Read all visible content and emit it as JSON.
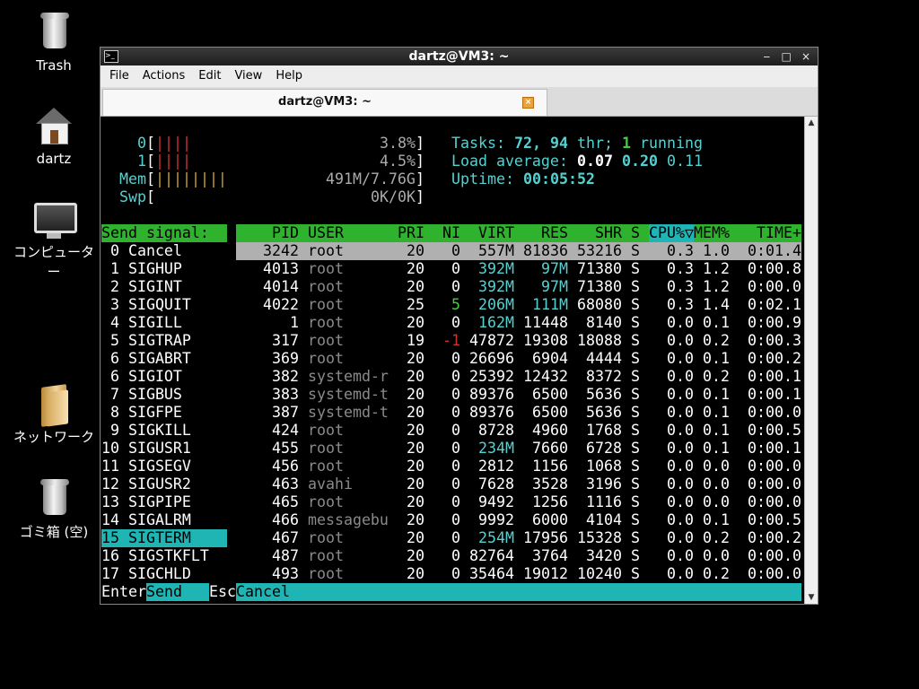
{
  "desktop": {
    "icons": [
      {
        "label": "Trash",
        "icon": "trash-icon"
      },
      {
        "label": "dartz",
        "icon": "home-folder-icon"
      },
      {
        "label": "コンピューター",
        "icon": "computer-icon"
      },
      {
        "label": "ネットワーク",
        "icon": "network-folder-icon"
      },
      {
        "label": "ゴミ箱 (空)",
        "icon": "trash-empty-icon"
      }
    ]
  },
  "window": {
    "title": "dartz@VM3: ~",
    "controls": {
      "minimize": "‒",
      "maximize": "□",
      "close": "×"
    },
    "menu": [
      "File",
      "Actions",
      "Edit",
      "View",
      "Help"
    ],
    "tab_title": "dartz@VM3: ~",
    "tab_close": "×"
  },
  "htop": {
    "cpu0": {
      "label": "0",
      "bar": "||||",
      "value": "3.8%"
    },
    "cpu1": {
      "label": "1",
      "bar": "||||",
      "value": "4.5%"
    },
    "mem": {
      "label": "Mem",
      "bar": "||||||||",
      "value": "491M/7.76G"
    },
    "swp": {
      "label": "Swp",
      "bar": "",
      "value": "0K/0K"
    },
    "tasks": {
      "label": "Tasks:",
      "count": "72,",
      "thr": "94",
      "thr_label": "thr;",
      "running": "1",
      "running_label": "running"
    },
    "load": {
      "label": "Load average:",
      "v1": "0.07",
      "v5": "0.20",
      "v15": "0.11"
    },
    "uptime": {
      "label": "Uptime:",
      "value": "00:05:52"
    },
    "signal_panel": {
      "title": "Send signal:",
      "items": [
        "0 Cancel",
        "1 SIGHUP",
        "2 SIGINT",
        "3 SIGQUIT",
        "4 SIGILL",
        "5 SIGTRAP",
        "6 SIGABRT",
        "6 SIGIOT",
        "7 SIGBUS",
        "8 SIGFPE",
        "9 SIGKILL",
        "10 SIGUSR1",
        "11 SIGSEGV",
        "12 SIGUSR2",
        "13 SIGPIPE",
        "14 SIGALRM",
        "15 SIGTERM",
        "16 SIGSTKFLT",
        "17 SIGCHLD"
      ],
      "selected": "15 SIGTERM"
    },
    "columns": [
      "PID",
      "USER",
      "PRI",
      "NI",
      "VIRT",
      "RES",
      "SHR",
      "S",
      "CPU%▽",
      "MEM%",
      "TIME+"
    ],
    "processes": [
      [
        "3242",
        "root",
        "20",
        "0",
        "557M",
        "81836",
        "53216",
        "S",
        "0.3",
        "1.0",
        "0:01.4"
      ],
      [
        "4013",
        "root",
        "20",
        "0",
        "392M",
        "97M",
        "71380",
        "S",
        "0.3",
        "1.2",
        "0:00.8"
      ],
      [
        "4014",
        "root",
        "20",
        "0",
        "392M",
        "97M",
        "71380",
        "S",
        "0.3",
        "1.2",
        "0:00.0"
      ],
      [
        "4022",
        "root",
        "25",
        "5",
        "206M",
        "111M",
        "68080",
        "S",
        "0.3",
        "1.4",
        "0:02.1"
      ],
      [
        "1",
        "root",
        "20",
        "0",
        "162M",
        "11448",
        "8140",
        "S",
        "0.0",
        "0.1",
        "0:00.9"
      ],
      [
        "317",
        "root",
        "19",
        "-1",
        "47872",
        "19308",
        "18088",
        "S",
        "0.0",
        "0.2",
        "0:00.3"
      ],
      [
        "369",
        "root",
        "20",
        "0",
        "26696",
        "6904",
        "4444",
        "S",
        "0.0",
        "0.1",
        "0:00.2"
      ],
      [
        "382",
        "systemd-r",
        "20",
        "0",
        "25392",
        "12432",
        "8372",
        "S",
        "0.0",
        "0.2",
        "0:00.1"
      ],
      [
        "383",
        "systemd-t",
        "20",
        "0",
        "89376",
        "6500",
        "5636",
        "S",
        "0.0",
        "0.1",
        "0:00.1"
      ],
      [
        "387",
        "systemd-t",
        "20",
        "0",
        "89376",
        "6500",
        "5636",
        "S",
        "0.0",
        "0.1",
        "0:00.0"
      ],
      [
        "424",
        "root",
        "20",
        "0",
        "8728",
        "4960",
        "1768",
        "S",
        "0.0",
        "0.1",
        "0:00.5"
      ],
      [
        "455",
        "root",
        "20",
        "0",
        "234M",
        "7660",
        "6728",
        "S",
        "0.0",
        "0.1",
        "0:00.1"
      ],
      [
        "456",
        "root",
        "20",
        "0",
        "2812",
        "1156",
        "1068",
        "S",
        "0.0",
        "0.0",
        "0:00.0"
      ],
      [
        "463",
        "avahi",
        "20",
        "0",
        "7628",
        "3528",
        "3196",
        "S",
        "0.0",
        "0.0",
        "0:00.0"
      ],
      [
        "465",
        "root",
        "20",
        "0",
        "9492",
        "1256",
        "1116",
        "S",
        "0.0",
        "0.0",
        "0:00.0"
      ],
      [
        "466",
        "messagebu",
        "20",
        "0",
        "9992",
        "6000",
        "4104",
        "S",
        "0.0",
        "0.1",
        "0:00.5"
      ],
      [
        "467",
        "root",
        "20",
        "0",
        "254M",
        "17956",
        "15328",
        "S",
        "0.0",
        "0.2",
        "0:00.2"
      ],
      [
        "487",
        "root",
        "20",
        "0",
        "82764",
        "3764",
        "3420",
        "S",
        "0.0",
        "0.0",
        "0:00.0"
      ],
      [
        "493",
        "root",
        "20",
        "0",
        "35464",
        "19012",
        "10240",
        "S",
        "0.0",
        "0.2",
        "0:00.0"
      ]
    ],
    "footer": {
      "key1": "Enter",
      "label1": "Send",
      "key2": "Esc",
      "label2": "Cancel"
    },
    "colors": {
      "green": "#2fb32f",
      "cyan": "#1fb5b5",
      "text_cyan": "#56d1d1",
      "selection": "#b0b0b0"
    }
  }
}
